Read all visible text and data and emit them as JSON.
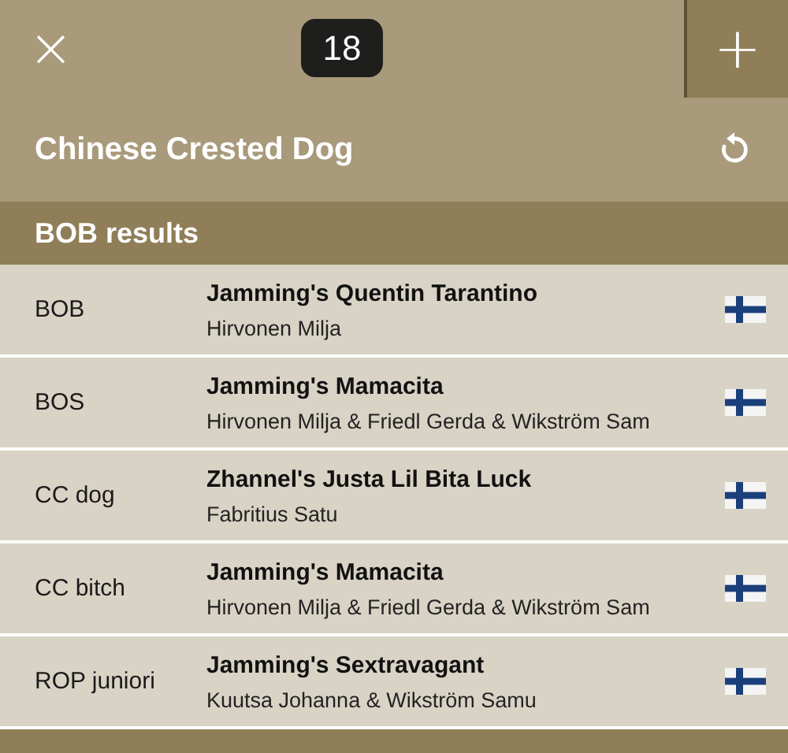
{
  "top_bar": {
    "close": "×",
    "count": "18",
    "add": "+"
  },
  "title": "Chinese Crested Dog",
  "section": "BOB results",
  "results": [
    {
      "award": "BOB",
      "dog": "Jamming's Quentin Tarantino",
      "owners": "Hirvonen Milja"
    },
    {
      "award": "BOS",
      "dog": "Jamming's Mamacita",
      "owners": "Hirvonen Milja & Friedl Gerda & Wikström Sam"
    },
    {
      "award": "CC dog",
      "dog": "Zhannel's Justa Lil Bita Luck",
      "owners": "Fabritius Satu"
    },
    {
      "award": "CC bitch",
      "dog": "Jamming's Mamacita",
      "owners": "Hirvonen Milja & Friedl Gerda & Wikström Sam"
    },
    {
      "award": "ROP juniori",
      "dog": "Jamming's Sextravagant",
      "owners": "Kuutsa Johanna & Wikström Samu"
    }
  ]
}
